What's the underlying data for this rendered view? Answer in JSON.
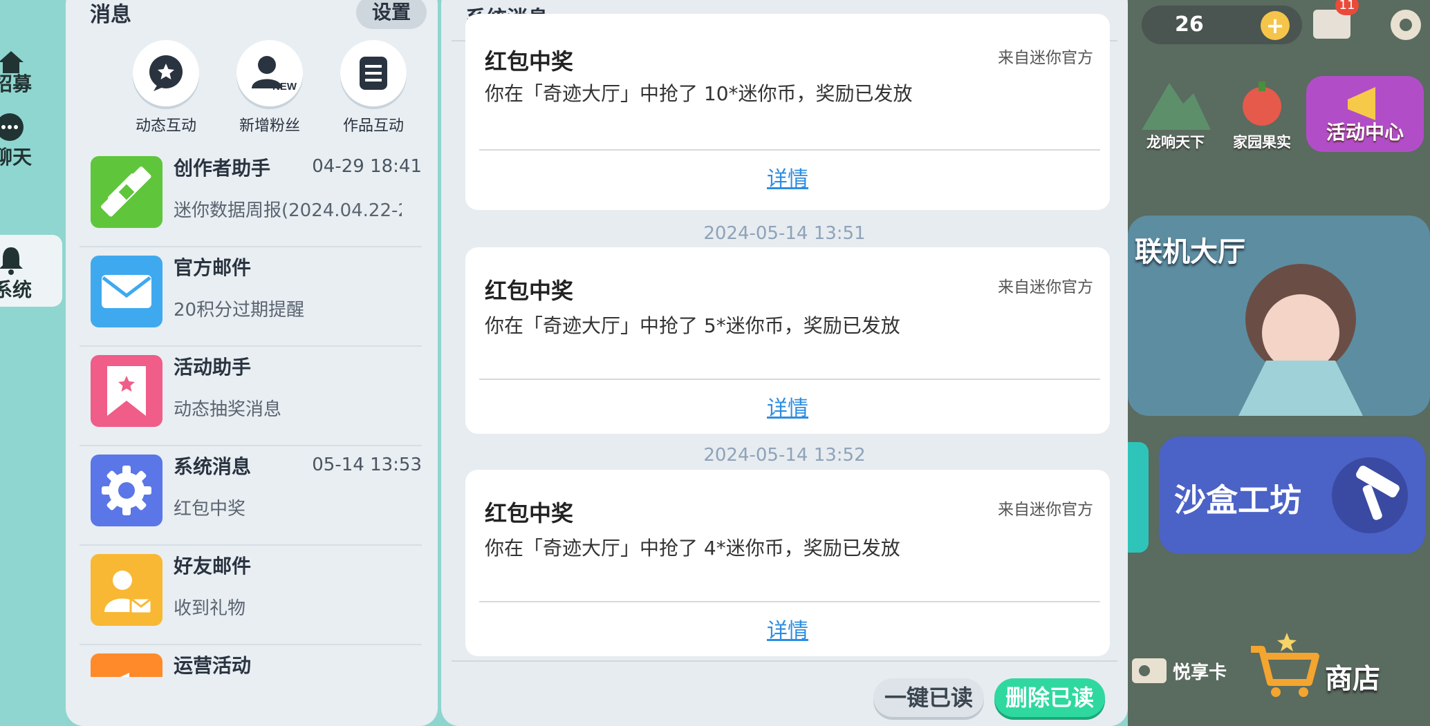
{
  "rail": {
    "items": [
      {
        "label": "招募"
      },
      {
        "label": "聊天"
      },
      {
        "label": "系统"
      }
    ]
  },
  "messages_panel": {
    "title": "消息",
    "settings_label": "设置",
    "quick_actions": [
      {
        "label": "动态互动",
        "icon": "star-bubble-icon"
      },
      {
        "label": "新增粉丝",
        "icon": "new-follower-icon"
      },
      {
        "label": "作品互动",
        "icon": "list-document-icon"
      }
    ],
    "threads": [
      {
        "title": "创作者助手",
        "time": "04-29 18:41",
        "preview": "迷你数据周报(2024.04.22-2",
        "icon": "ruler-pencil-icon",
        "color": "#5fc63b"
      },
      {
        "title": "官方邮件",
        "time": "",
        "preview": "20积分过期提醒",
        "icon": "envelope-icon",
        "color": "#3fa9ef"
      },
      {
        "title": "活动助手",
        "time": "",
        "preview": "动态抽奖消息",
        "icon": "bookmark-star-icon",
        "color": "#ef5d88"
      },
      {
        "title": "系统消息",
        "time": "05-14 13:53",
        "preview": "红包中奖",
        "icon": "gear-icon",
        "color": "#5b76e6"
      },
      {
        "title": "好友邮件",
        "time": "",
        "preview": "收到礼物",
        "icon": "friend-mail-icon",
        "color": "#f8b834"
      },
      {
        "title": "运营活动",
        "time": "",
        "preview": "",
        "icon": "megaphone-icon",
        "color": "#ff8a2a"
      }
    ]
  },
  "system_panel": {
    "title": "系统消息",
    "cards": [
      {
        "title": "红包中奖",
        "source": "来自迷你官方",
        "body": "你在「奇迹大厅」中抢了 10*迷你币，奖励已发放",
        "link": "详情"
      },
      {
        "timestamp": "2024-05-14 13:51",
        "title": "红包中奖",
        "source": "来自迷你官方",
        "body": "你在「奇迹大厅」中抢了 5*迷你币，奖励已发放",
        "link": "详情"
      },
      {
        "timestamp": "2024-05-14 13:52",
        "title": "红包中奖",
        "source": "来自迷你官方",
        "body": "你在「奇迹大厅」中抢了 4*迷你币，奖励已发放",
        "link": "详情"
      }
    ],
    "mark_all_read": "一键已读",
    "delete_read": "删除已读"
  },
  "game_bg": {
    "coins": "26",
    "mail_badge": "11",
    "tiles": [
      {
        "label": "龙响天下"
      },
      {
        "label": "家园果实"
      },
      {
        "label": "活动中心"
      }
    ],
    "hall_label": "联机大厅",
    "sandbox_label": "沙盒工坊",
    "pass_label": "悦享卡",
    "shop_label": "商店"
  },
  "colors": {
    "accent_green": "#2fd89f",
    "link_blue": "#2e8de0",
    "timestamp": "#8fa2b8"
  }
}
